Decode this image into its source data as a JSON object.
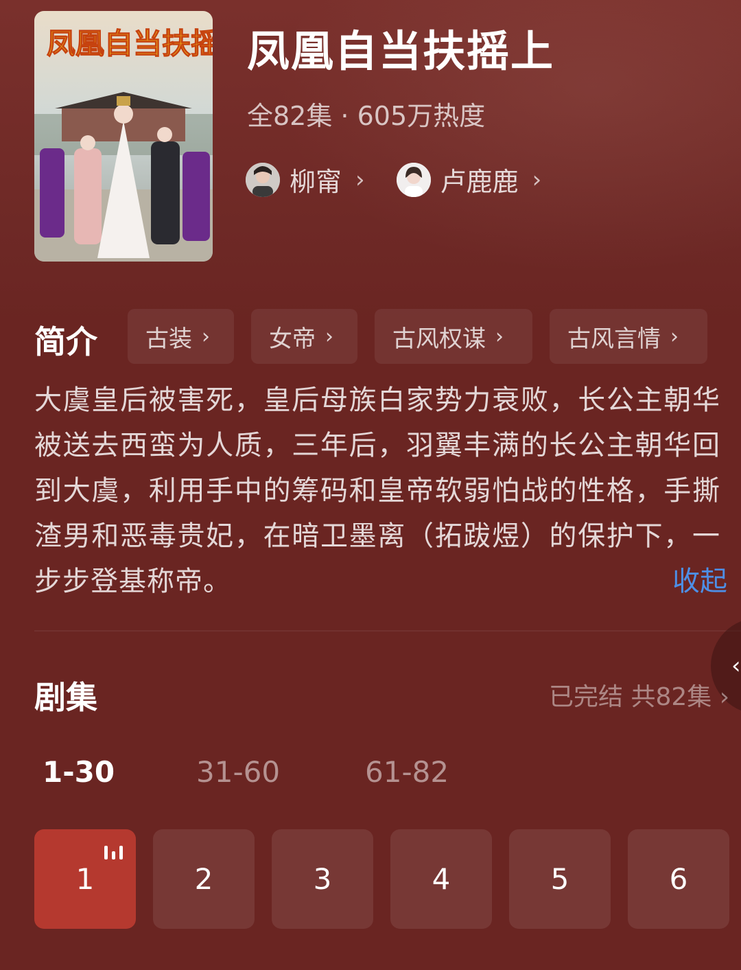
{
  "drama": {
    "title": "凤凰自当扶摇上",
    "meta": "全82集 · 605万热度",
    "poster_title": "凤凰自当扶摇上"
  },
  "actors": [
    {
      "name": "柳甯",
      "chevron": "›"
    },
    {
      "name": "卢鹿鹿",
      "chevron": "›"
    }
  ],
  "intro": {
    "label": "简介",
    "tags": [
      {
        "label": "古装",
        "chevron": "›"
      },
      {
        "label": "女帝",
        "chevron": "›"
      },
      {
        "label": "古风权谋",
        "chevron": "›"
      },
      {
        "label": "古风言情",
        "chevron": "›"
      }
    ],
    "synopsis": "大虞皇后被害死，皇后母族白家势力衰败，长公主朝华被送去西蛮为人质，三年后，羽翼丰满的长公主朝华回到大虞，利用手中的筹码和皇帝软弱怕战的性格，手撕渣男和恶毒贵妃，在暗卫墨离（拓跋煜）的保护下，一步步登基称帝。",
    "collapse_label": "收起"
  },
  "episodes": {
    "label": "剧集",
    "status": "已完结 共82集",
    "status_chevron": "›",
    "ranges": [
      "1-30",
      "31-60",
      "61-82"
    ],
    "active_range": "1-30",
    "items": [
      "1",
      "2",
      "3",
      "4",
      "5",
      "6"
    ],
    "playing": "1"
  },
  "side_handle_icon": "‹",
  "colors": {
    "background": "#6a2522",
    "active_episode": "#b5392f",
    "link_blue": "#4d8fe6"
  },
  "icons": {
    "playing": "playing-bars-icon",
    "chevron": "chevron-right-icon",
    "collapse_handle": "chevron-left-icon"
  }
}
